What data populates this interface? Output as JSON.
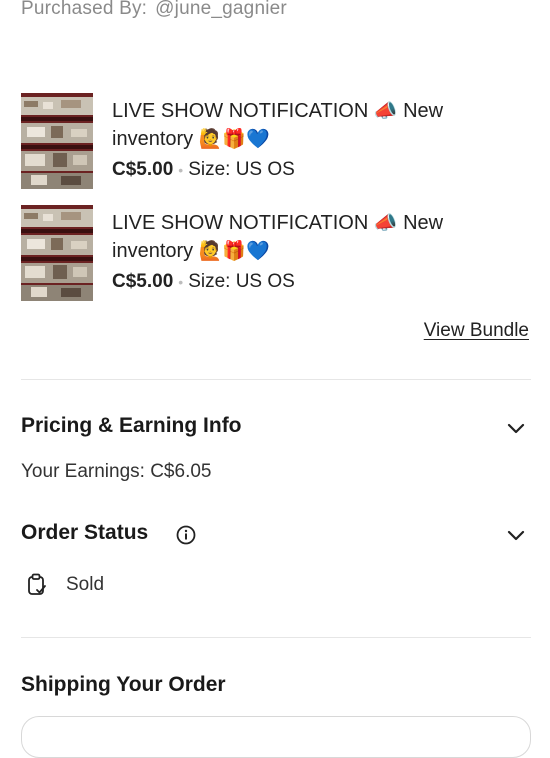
{
  "purchased_by": {
    "label": "Purchased By:",
    "user": "@june_gagnier"
  },
  "items": [
    {
      "title_prefix": "LIVE SHOW NOTIFICATION",
      "title_emoji1": "📣",
      "title_mid": "New inventory",
      "title_emojis": "🙋🎁💙",
      "price": "C$5.00",
      "size": "Size: US OS"
    },
    {
      "title_prefix": "LIVE SHOW NOTIFICATION",
      "title_emoji1": "📣",
      "title_mid": "New inventory",
      "title_emojis": "🙋🎁💙",
      "price": "C$5.00",
      "size": "Size: US OS"
    }
  ],
  "view_bundle": "View Bundle",
  "pricing": {
    "title": "Pricing & Earning Info",
    "earnings": "Your Earnings: C$6.05"
  },
  "order_status": {
    "title": "Order Status",
    "status": "Sold"
  },
  "shipping": {
    "title": "Shipping Your Order"
  },
  "icons": {
    "chevron": "chevron-down-icon",
    "info": "info-icon",
    "status": "clipboard-check-icon"
  },
  "colors": {
    "text": "#1f1f1f",
    "muted": "#8a8a8a",
    "divider": "#e6e6e6"
  }
}
